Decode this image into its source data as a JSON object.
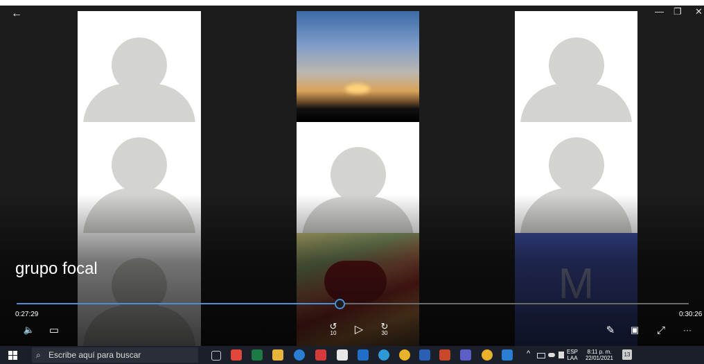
{
  "window": {
    "back_glyph": "←",
    "minimize_glyph": "—",
    "restore_glyph": "❐",
    "close_glyph": "✕"
  },
  "video": {
    "title": "grupo focal",
    "current_time": "0:27:29",
    "total_time": "0:30:26",
    "progress": 0.48,
    "participant_initial": "M"
  },
  "controls": {
    "volume_glyph": "🔈",
    "subtitles_glyph": "▭",
    "rewind_label": "10",
    "play_glyph": "▷",
    "forward_label": "30",
    "pen_glyph": "✎",
    "miniview_glyph": "▣",
    "fullscreen_glyph": "⤢",
    "more_glyph": "···"
  },
  "taskbar": {
    "search_placeholder": "Escribe aquí para buscar",
    "search_glyph": "⌕",
    "tray": {
      "lang_line1": "ESP",
      "lang_line2": "LAA",
      "time": "8:11 p. m.",
      "date": "22/01/2021",
      "notifications": "13",
      "chevron": "^"
    }
  },
  "colors": {
    "accent": "#4a90d9",
    "avatar": "#d3d3d0",
    "initial_tile": "#3f4fa3"
  }
}
